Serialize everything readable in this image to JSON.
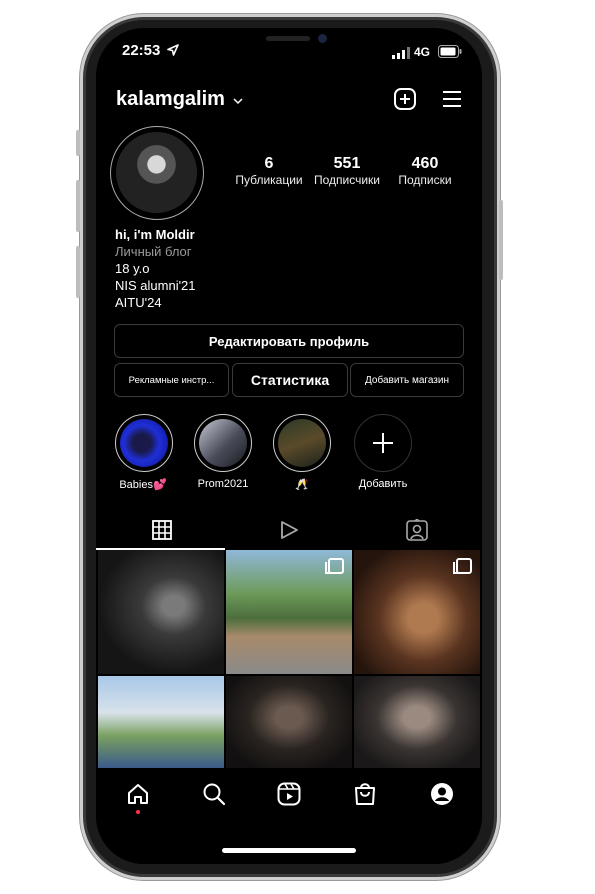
{
  "status_bar": {
    "time": "22:53",
    "network": "4G"
  },
  "profile": {
    "username": "kalamgalim",
    "stats": [
      {
        "value": "6",
        "label": "Публикации"
      },
      {
        "value": "551",
        "label": "Подписчики"
      },
      {
        "value": "460",
        "label": "Подписки"
      }
    ],
    "bio": {
      "name": "hi, i'm Moldir",
      "category": "Личный блог",
      "lines": [
        "18 y.o",
        "NIS alumni'21",
        "AITU'24"
      ]
    }
  },
  "buttons": {
    "edit_profile": "Редактировать профиль",
    "ad_tools": "Рекламные инстр...",
    "insights": "Статистика",
    "add_shop": "Добавить магазин"
  },
  "highlights": [
    {
      "label": "Babies💕"
    },
    {
      "label": "Prom2021"
    },
    {
      "label": "🥂"
    },
    {
      "label": "Добавить"
    }
  ],
  "tabs": [
    "grid-tab",
    "reels-tab",
    "tagged-tab"
  ],
  "posts": [
    {
      "icon": ""
    },
    {
      "icon": "multi-photo-icon"
    },
    {
      "icon": "multi-photo-icon"
    },
    {
      "icon": ""
    },
    {
      "icon": ""
    },
    {
      "icon": ""
    }
  ],
  "bottom_nav": [
    "home-icon",
    "search-icon",
    "reels-icon",
    "shop-icon",
    "profile-icon"
  ],
  "colors": {
    "background": "#000000",
    "text": "#ffffff",
    "border": "#3a3a3a",
    "notification_dot": "#ff3040"
  }
}
